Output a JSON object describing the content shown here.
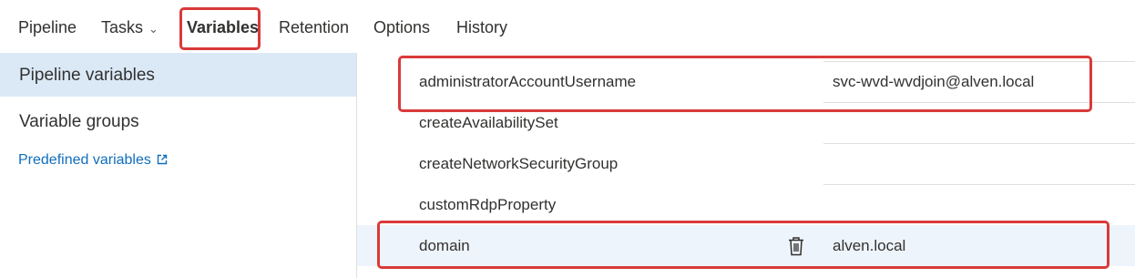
{
  "tabs": [
    {
      "label": "Pipeline"
    },
    {
      "label": "Tasks",
      "chevron": "chevron-down-icon"
    },
    {
      "label": "Variables",
      "active": true
    },
    {
      "label": "Retention"
    },
    {
      "label": "Options"
    },
    {
      "label": "History"
    }
  ],
  "sidebar": {
    "items": [
      {
        "label": "Pipeline variables",
        "selected": true
      },
      {
        "label": "Variable groups"
      }
    ],
    "link": {
      "label": "Predefined variables",
      "icon": "external-link-icon"
    }
  },
  "variables": [
    {
      "name": "administratorAccountUsername",
      "value": "svc-wvd-wvdjoin@alven.local"
    },
    {
      "name": "createAvailabilitySet",
      "value": ""
    },
    {
      "name": "createNetworkSecurityGroup",
      "value": ""
    },
    {
      "name": "customRdpProperty",
      "value": ""
    },
    {
      "name": "domain",
      "value": "alven.local",
      "selected": true,
      "action_icon": "trash-icon"
    }
  ],
  "colors": {
    "highlight": "#d93a3a",
    "link": "#106ebe",
    "selected_sidebar": "#dbe9f7",
    "selected_row": "#eef4fb"
  }
}
